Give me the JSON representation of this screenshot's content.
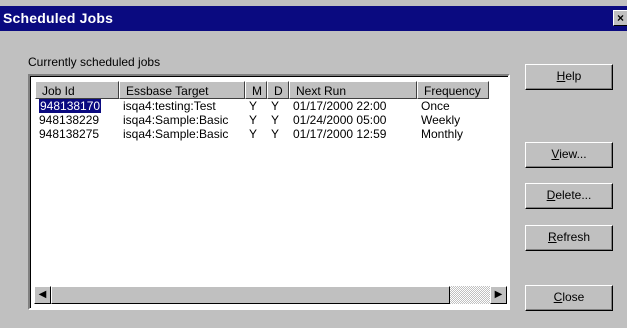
{
  "window": {
    "title": "Scheduled Jobs",
    "close_label": "×"
  },
  "group_label": "Currently scheduled jobs",
  "columns": [
    "Job Id",
    "Essbase Target",
    "M",
    "D",
    "Next Run",
    "Frequency"
  ],
  "rows": [
    [
      "948138170",
      "isqa4:testing:Test",
      "Y",
      "Y",
      "01/17/2000 22:00",
      "Once"
    ],
    [
      "948138229",
      "isqa4:Sample:Basic",
      "Y",
      "Y",
      "01/24/2000 05:00",
      "Weekly"
    ],
    [
      "948138275",
      "isqa4:Sample:Basic",
      "Y",
      "Y",
      "01/17/2000 12:59",
      "Monthly"
    ]
  ],
  "buttons": {
    "help": {
      "mnemonic": "H",
      "rest": "elp"
    },
    "view": {
      "mnemonic": "V",
      "rest": "iew..."
    },
    "delete": {
      "mnemonic": "D",
      "rest": "elete..."
    },
    "refresh": {
      "mnemonic": "R",
      "rest": "efresh"
    },
    "close": {
      "mnemonic": "C",
      "rest": "lose"
    }
  },
  "scrollbar": {
    "left_arrow": "◀",
    "right_arrow": "▶"
  },
  "selected_row": 0
}
